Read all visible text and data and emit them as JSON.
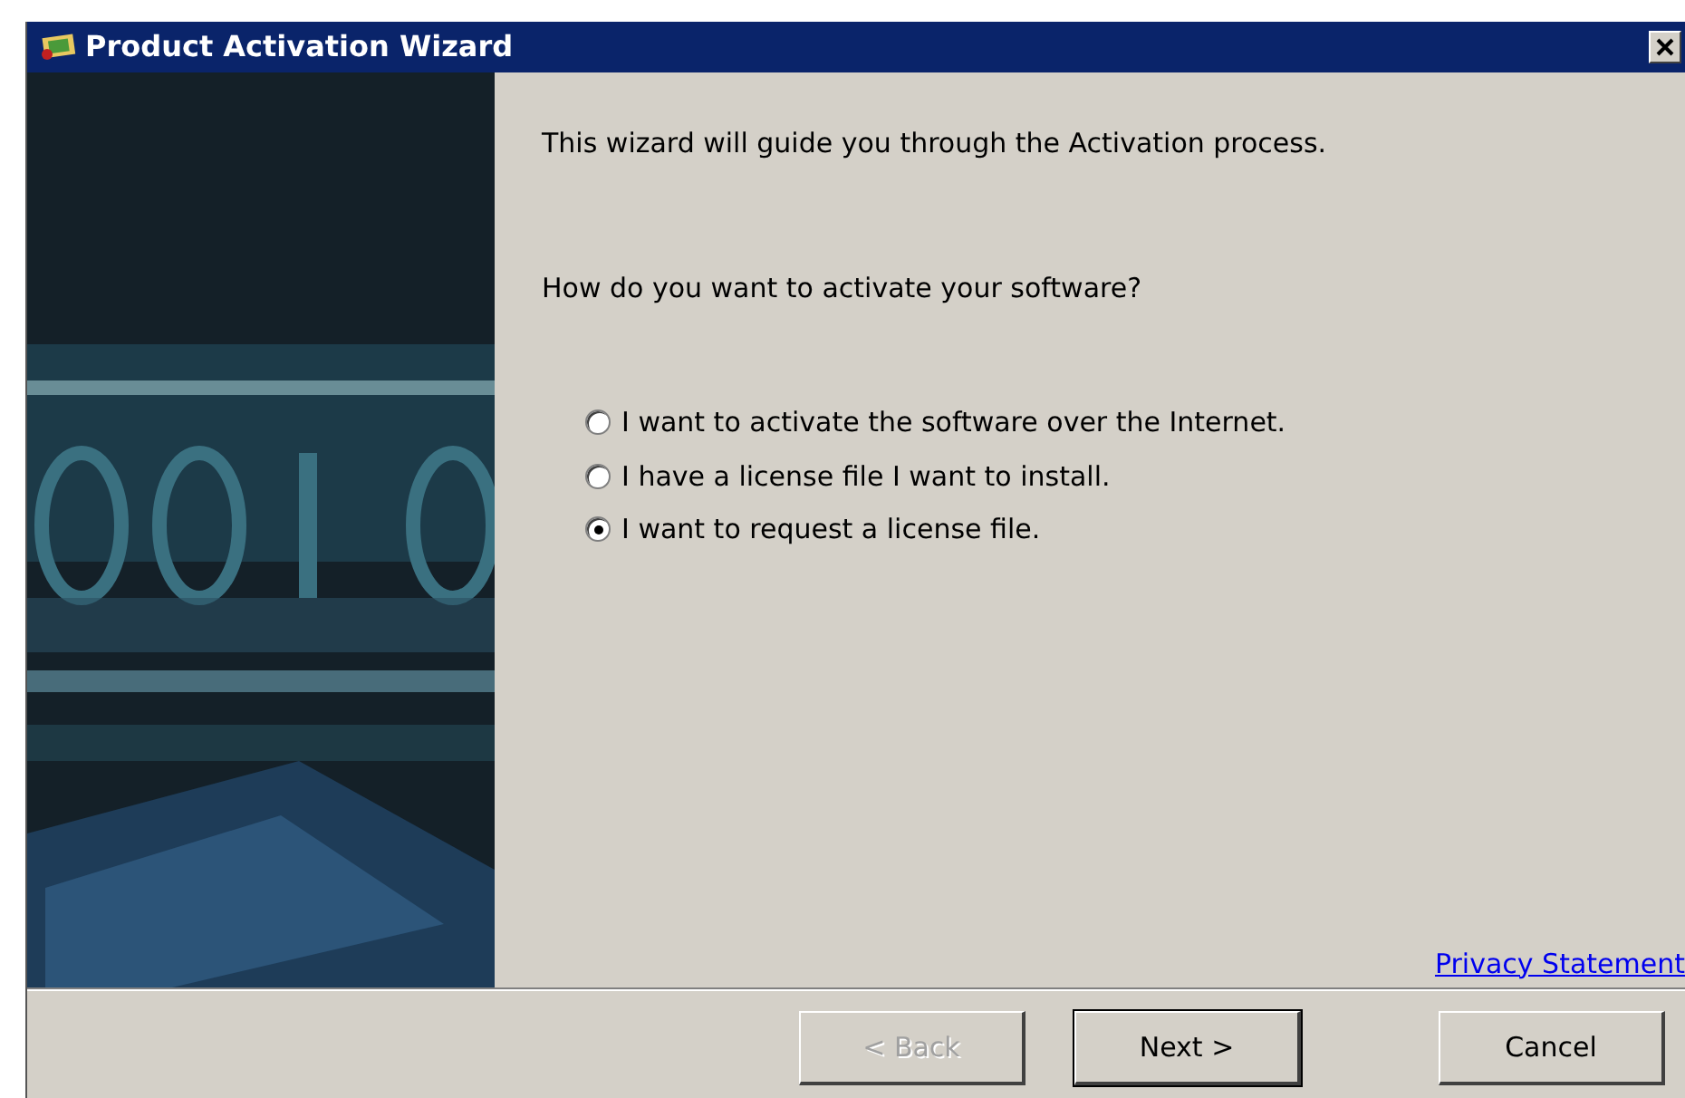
{
  "window": {
    "title": "Product Activation Wizard"
  },
  "intro": "This wizard will guide you through the Activation process.",
  "question": "How do you want to activate your software?",
  "options": [
    {
      "label": "I want to activate the software over the Internet.",
      "selected": false
    },
    {
      "label": "I have a license file I want to install.",
      "selected": false
    },
    {
      "label": "I want to request a license file.",
      "selected": true
    }
  ],
  "privacy_link": "Privacy Statement",
  "buttons": [
    {
      "label": "< Back",
      "disabled": true,
      "default": false
    },
    {
      "label": "Next >",
      "disabled": false,
      "default": true
    },
    {
      "label": "Cancel",
      "disabled": false,
      "default": false
    }
  ]
}
